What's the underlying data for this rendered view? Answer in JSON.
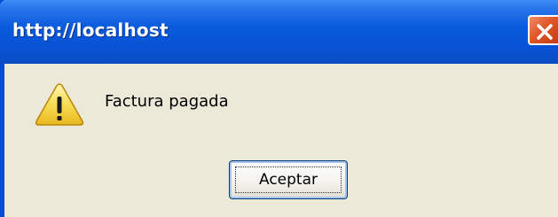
{
  "window": {
    "title": "http://localhost",
    "close_icon": "close-icon"
  },
  "content": {
    "icon": "warning-icon",
    "message": "Factura pagada"
  },
  "buttons": {
    "ok_label": "Aceptar"
  },
  "colors": {
    "titlebar": "#0852d4",
    "dialog_bg": "#ece9d8",
    "close_button": "#e0572a",
    "warning_yellow": "#f5d84a"
  }
}
